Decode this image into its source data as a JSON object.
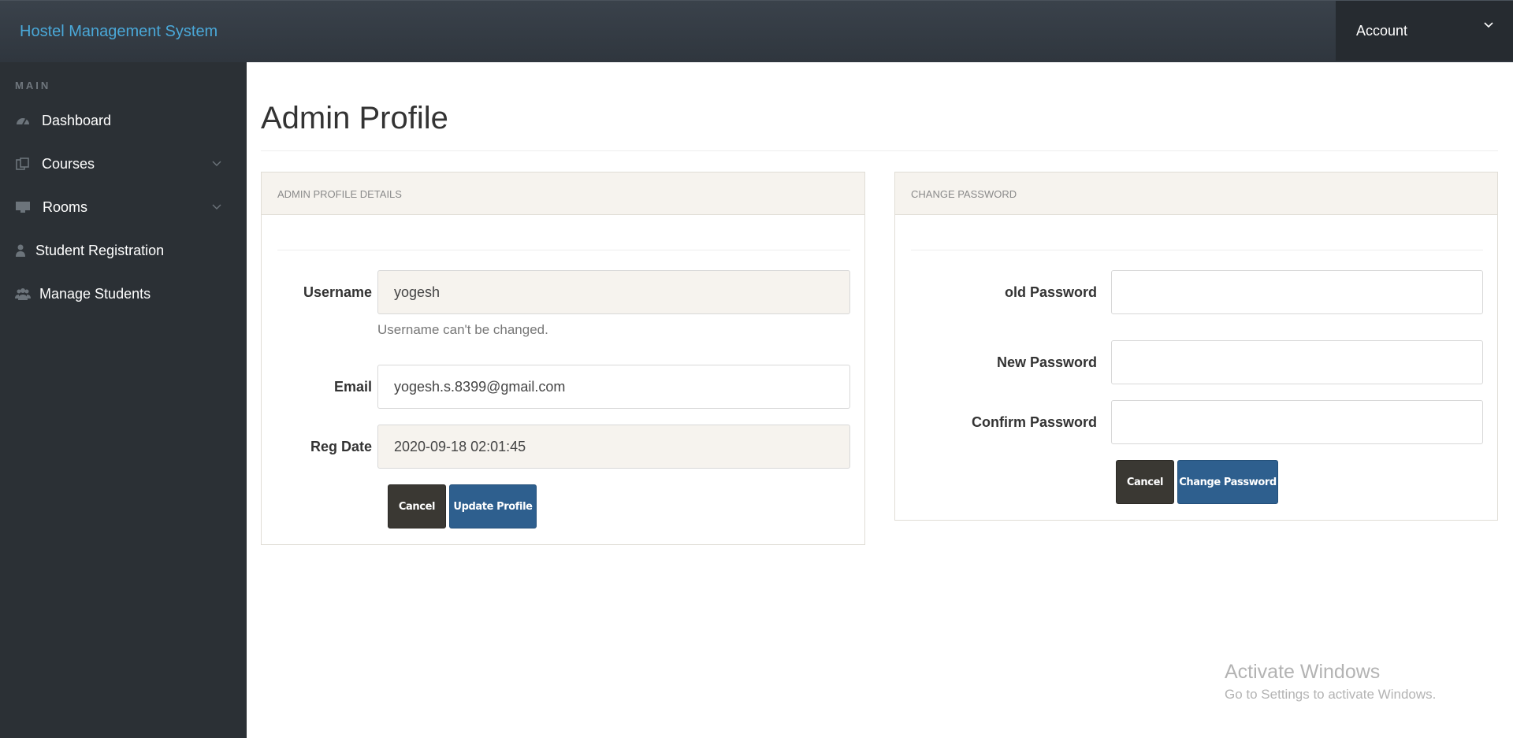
{
  "app": {
    "brand": "Hostel Management System"
  },
  "account": {
    "label": "Account",
    "icon": "chevron-down-icon"
  },
  "sidebar": {
    "heading": "MAIN",
    "items": [
      {
        "label": "Dashboard",
        "icon": "dashboard-icon"
      },
      {
        "label": "Courses",
        "icon": "files-icon",
        "has_submenu": true
      },
      {
        "label": "Rooms",
        "icon": "desktop-icon",
        "has_submenu": true
      },
      {
        "label": "Student Registration",
        "icon": "user-icon"
      },
      {
        "label": "Manage Students",
        "icon": "users-icon"
      }
    ]
  },
  "page": {
    "title": "Admin Profile"
  },
  "profile_panel": {
    "heading": "ADMIN PROFILE DETAILS",
    "username_label": "Username",
    "username_value": "yogesh",
    "username_help": "Username can't be changed.",
    "email_label": "Email",
    "email_value": "yogesh.s.8399@gmail.com",
    "regdate_label": "Reg Date",
    "regdate_value": "2020-09-18 02:01:45",
    "cancel_label": "Cancel",
    "update_label": "Update Profile"
  },
  "password_panel": {
    "heading": "CHANGE PASSWORD",
    "old_label": "old Password",
    "new_label": "New Password",
    "confirm_label": "Confirm Password",
    "cancel_label": "Cancel",
    "change_label": "Change Password"
  },
  "watermark": {
    "title": "Activate Windows",
    "subtitle": "Go to Settings to activate Windows."
  },
  "colors": {
    "topbar": "#343b43",
    "sidebar": "#2b3035",
    "brand": "#4aa8d8",
    "primary_button": "#2e5f8e",
    "dark_button": "#3a3833",
    "panel_header": "#f6f3ee"
  }
}
